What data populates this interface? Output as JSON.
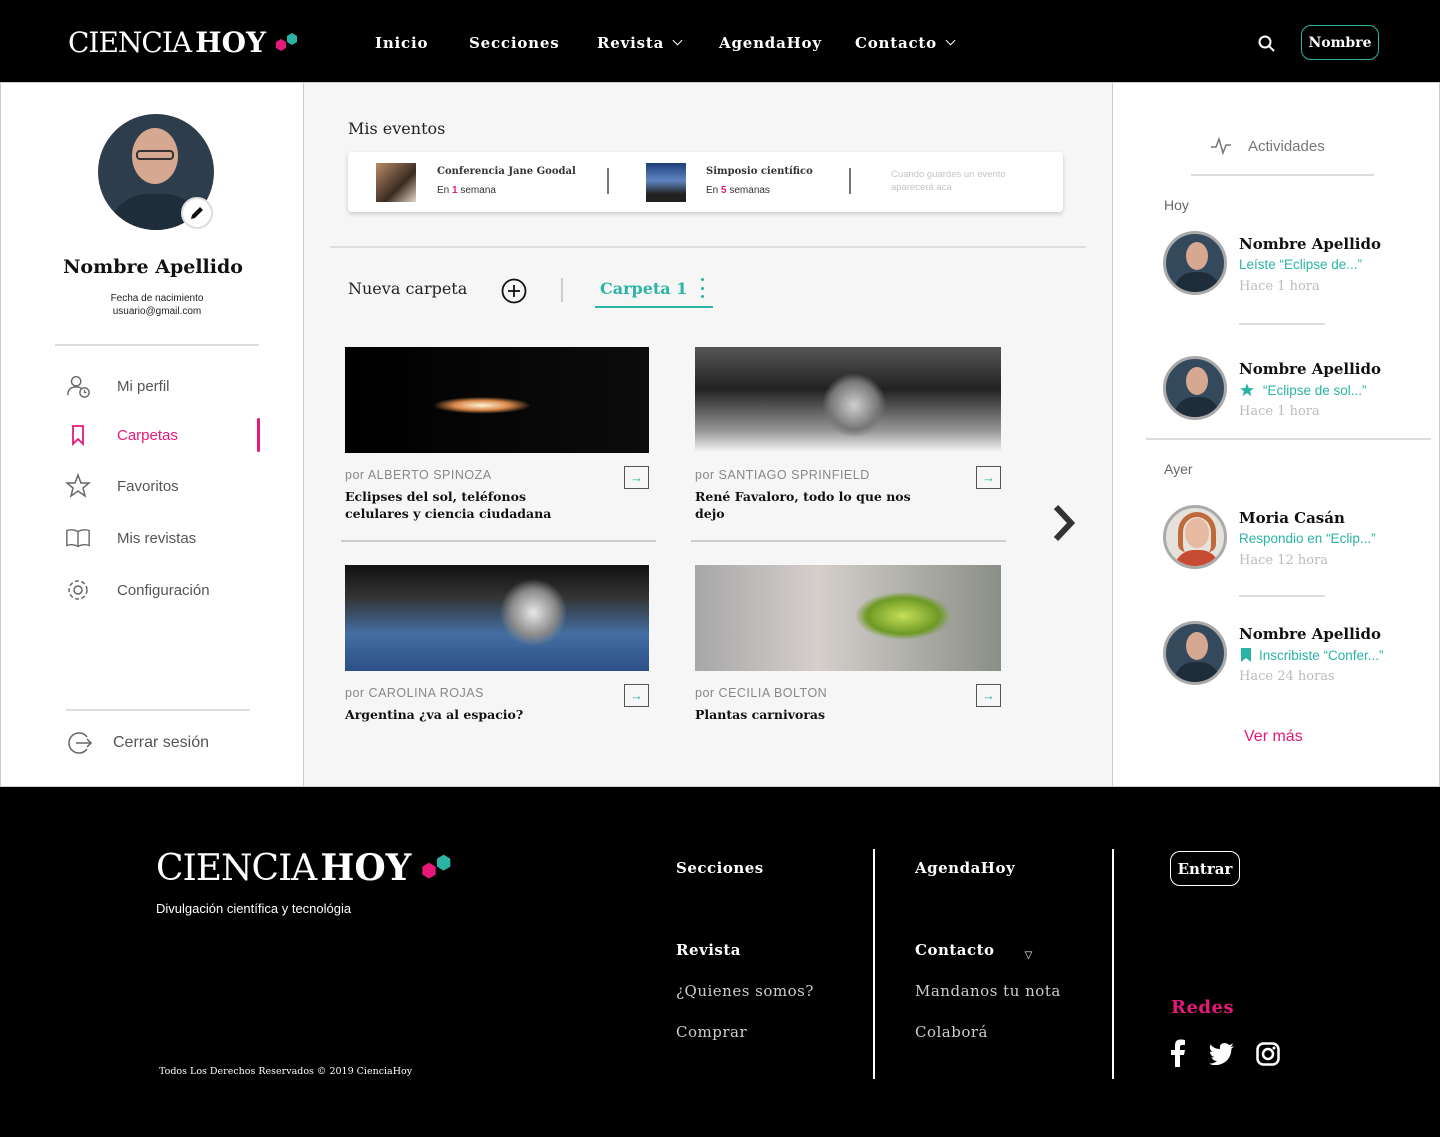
{
  "brand": {
    "word1": "CIENCIA",
    "word2": "HOY",
    "accent_pink": "#e6197a",
    "accent_teal": "#2bb3a5"
  },
  "nav": {
    "items": [
      {
        "label": "Inicio"
      },
      {
        "label": "Secciones"
      },
      {
        "label": "Revista"
      },
      {
        "label": "AgendaHoy"
      },
      {
        "label": "Contacto"
      }
    ],
    "user_button": "Nombre",
    "search_icon": "search-icon"
  },
  "profile": {
    "name": "Nombre Apellido",
    "birth": "Fecha de nacimiento",
    "email": "usuario@gmail.com",
    "menu": [
      {
        "label": "Mi perfil",
        "icon": "user-clock-icon"
      },
      {
        "label": "Carpetas",
        "icon": "bookmark-icon",
        "active": true
      },
      {
        "label": "Favoritos",
        "icon": "star-icon"
      },
      {
        "label": "Mis revistas",
        "icon": "book-icon"
      },
      {
        "label": "Configuración",
        "icon": "gear-icon"
      }
    ],
    "logout": "Cerrar sesión"
  },
  "events": {
    "title": "Mis eventos",
    "items": [
      {
        "title": "Conferencia Jane Goodal",
        "prefix": "En",
        "count": "1",
        "unit": "semana"
      },
      {
        "title": "Simposio científico",
        "prefix": "En",
        "count": "5",
        "unit": "semanas"
      }
    ],
    "empty": "Cuando guardes un evento aparecerá aca"
  },
  "folders": {
    "new_label": "Nueva carpeta",
    "active": "Carpeta 1"
  },
  "articles": [
    {
      "author": "por ALBERTO SPINOZA",
      "title": "Eclipses del sol, teléfonos celulares y ciencia ciudadana"
    },
    {
      "author": "por SANTIAGO SPRINFIELD",
      "title": "René Favaloro, todo lo que nos dejo"
    },
    {
      "author": "por CAROLINA ROJAS",
      "title": "Argentina ¿va al espacio?"
    },
    {
      "author": "por CECILIA BOLTON",
      "title": "Plantas carnivoras"
    }
  ],
  "activity": {
    "title": "Actividades",
    "today": "Hoy",
    "yesterday": "Ayer",
    "items": [
      {
        "name": "Nombre Apellido",
        "desc": "Leíste “Eclipse de...”",
        "time": "Hace 1 hora"
      },
      {
        "name": "Nombre Apellido",
        "desc": "“Eclipse de sol...”",
        "time": "Hace 1 hora",
        "icon": "star-icon"
      },
      {
        "name": "Moria Casán",
        "desc": "Respondio en “Eclip...”",
        "time": "Hace 12 hora"
      },
      {
        "name": "Nombre Apellido",
        "desc": "Inscribiste “Confer...”",
        "time": "Hace 24 horas",
        "icon": "bookmark-icon"
      }
    ],
    "more": "Ver más"
  },
  "footer": {
    "tagline": "Divulgación científica y tecnológia",
    "copyright": "Todos Los Derechos Reservados © 2019 CienciaHoy",
    "col1": {
      "a": "Secciones",
      "b": "Revista",
      "c": "¿Quienes somos?",
      "d": "Comprar"
    },
    "col2": {
      "a": "AgendaHoy",
      "b": "Contacto",
      "c": "Mandanos tu nota",
      "d": "Colaborá"
    },
    "login": "Entrar",
    "social_title": "Redes",
    "social": [
      "facebook-icon",
      "twitter-icon",
      "instagram-icon"
    ]
  }
}
